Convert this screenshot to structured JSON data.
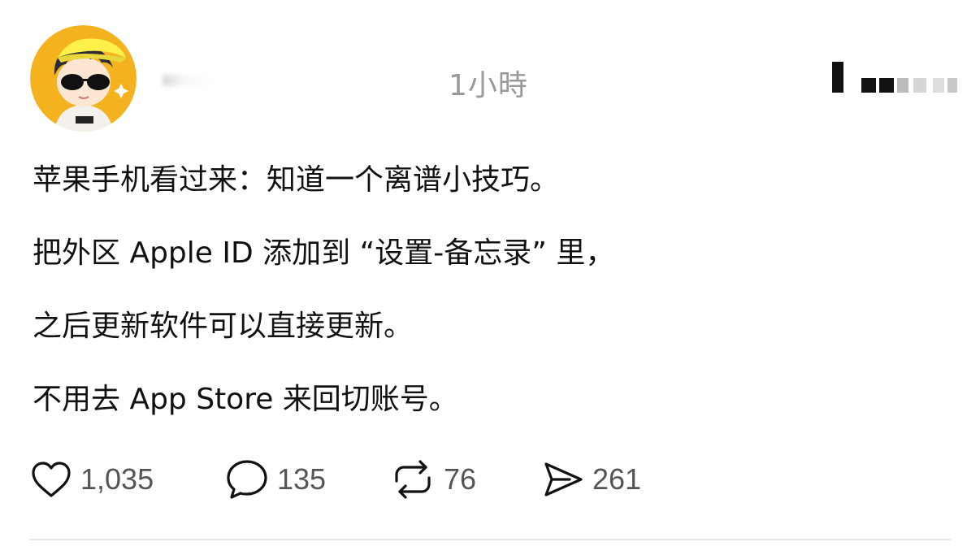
{
  "header": {
    "timestamp": "1小時"
  },
  "post": {
    "lines": [
      "苹果手机看过来：知道一个离谱小技巧。",
      "把外区 Apple ID 添加到 “设置-备忘录” 里，",
      "之后更新软件可以直接更新。",
      "不用去 App Store 来回切账号。"
    ]
  },
  "actions": {
    "likes": "1,035",
    "comments": "135",
    "reposts": "76",
    "shares": "261"
  },
  "colors": {
    "text": "#111111",
    "muted": "#999999",
    "count": "#555555",
    "divider": "#e6e6e6",
    "avatar_bg": "#f5b21f"
  },
  "icons": {
    "like": "heart-icon",
    "comment": "comment-bubble-icon",
    "repost": "repost-icon",
    "share": "send-icon"
  }
}
